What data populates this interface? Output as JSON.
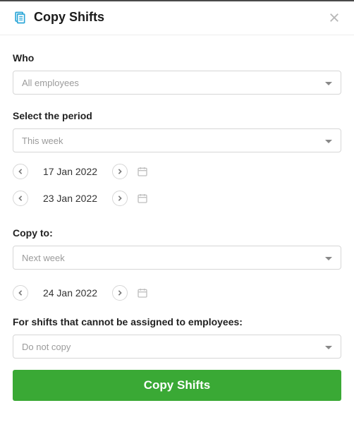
{
  "header": {
    "title": "Copy Shifts",
    "icon": "copy-document-icon",
    "close_label": "Close"
  },
  "who": {
    "label": "Who",
    "selected": "All employees"
  },
  "period": {
    "label": "Select the period",
    "selected": "This week",
    "start_date": "17 Jan 2022",
    "end_date": "23 Jan 2022"
  },
  "copy_to": {
    "label": "Copy to:",
    "selected": "Next week",
    "start_date": "24 Jan 2022"
  },
  "unassigned": {
    "label": "For shifts that cannot be assigned to employees:",
    "selected": "Do not copy"
  },
  "actions": {
    "submit": "Copy Shifts"
  }
}
